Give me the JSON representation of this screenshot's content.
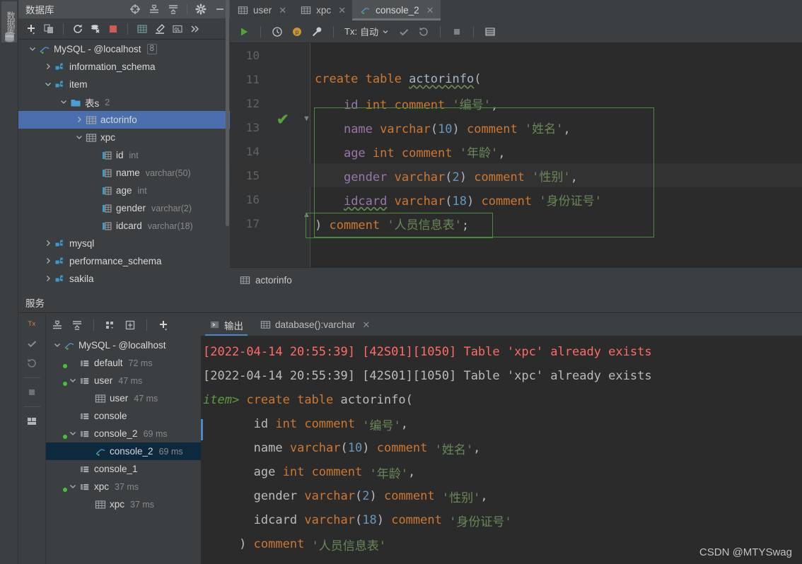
{
  "left_strip": {
    "vertical_tab_label": "数据库",
    "icon": "database-icon"
  },
  "db_panel": {
    "title": "数据库",
    "header_icons": [
      "crosshair-locate-icon",
      "expand-all-icon",
      "collapse-all-icon",
      "gear-icon",
      "minimize-icon"
    ],
    "toolbar_icons": [
      "add-icon",
      "copy-icon",
      "refresh-icon",
      "db-sync-icon",
      "stop-icon",
      "table-view-icon",
      "edit-icon",
      "query-console-icon",
      "more-chevrons-icon"
    ],
    "tree": [
      {
        "indent": 0,
        "arrow": "down",
        "icon": "mysql-icon",
        "label": "MySQL - @localhost",
        "badge": "8",
        "meta": "",
        "selected": false
      },
      {
        "indent": 1,
        "arrow": "right",
        "icon": "schema-icon",
        "label": "information_schema",
        "badge": "",
        "meta": "",
        "selected": false
      },
      {
        "indent": 1,
        "arrow": "down",
        "icon": "schema-icon",
        "label": "item",
        "badge": "",
        "meta": "",
        "selected": false
      },
      {
        "indent": 2,
        "arrow": "down",
        "icon": "folder-icon",
        "label": "表s",
        "badge": "",
        "meta": "2",
        "selected": false
      },
      {
        "indent": 3,
        "arrow": "right",
        "icon": "table-icon",
        "label": "actorinfo",
        "badge": "",
        "meta": "",
        "selected": true
      },
      {
        "indent": 3,
        "arrow": "down",
        "icon": "table-icon",
        "label": "xpc",
        "badge": "",
        "meta": "",
        "selected": false
      },
      {
        "indent": 4,
        "arrow": "none",
        "icon": "column-icon",
        "label": "id",
        "badge": "",
        "meta": "int",
        "selected": false
      },
      {
        "indent": 4,
        "arrow": "none",
        "icon": "column-icon",
        "label": "name",
        "badge": "",
        "meta": "varchar(50)",
        "selected": false
      },
      {
        "indent": 4,
        "arrow": "none",
        "icon": "column-icon",
        "label": "age",
        "badge": "",
        "meta": "int",
        "selected": false
      },
      {
        "indent": 4,
        "arrow": "none",
        "icon": "column-icon",
        "label": "gender",
        "badge": "",
        "meta": "varchar(2)",
        "selected": false
      },
      {
        "indent": 4,
        "arrow": "none",
        "icon": "column-icon",
        "label": "idcard",
        "badge": "",
        "meta": "varchar(18)",
        "selected": false
      },
      {
        "indent": 1,
        "arrow": "right",
        "icon": "schema-icon",
        "label": "mysql",
        "badge": "",
        "meta": "",
        "selected": false
      },
      {
        "indent": 1,
        "arrow": "right",
        "icon": "schema-icon",
        "label": "performance_schema",
        "badge": "",
        "meta": "",
        "selected": false
      },
      {
        "indent": 1,
        "arrow": "right",
        "icon": "schema-icon",
        "label": "sakila",
        "badge": "",
        "meta": "",
        "selected": false
      }
    ]
  },
  "editor": {
    "tabs": [
      {
        "label": "user",
        "icon": "table-icon",
        "active": false,
        "closable": true
      },
      {
        "label": "xpc",
        "icon": "table-icon",
        "active": false,
        "closable": true
      },
      {
        "label": "console_2",
        "icon": "mysql-icon",
        "active": true,
        "closable": true
      }
    ],
    "toolbar": {
      "run_label": "run-icon",
      "history_label": "history-icon",
      "profile_label": "p-badge-icon",
      "settings_label": "wrench-icon",
      "tx_label": "Tx:",
      "tx_value": "自动",
      "commit_label": "commit-icon",
      "rollback_label": "rollback-icon",
      "stop_label": "stop-icon",
      "datasource_label": "data-output-icon"
    },
    "lines": [
      {
        "num": "10",
        "tokens": [],
        "highlight": false
      },
      {
        "num": "11",
        "tokens": [
          {
            "t": "create table ",
            "c": "kw"
          },
          {
            "t": "actorinfo",
            "c": "ident wavy"
          },
          {
            "t": "(",
            "c": "plain"
          }
        ],
        "highlight": false
      },
      {
        "num": "12",
        "tokens": [
          {
            "t": "    ",
            "c": "plain"
          },
          {
            "t": "id",
            "c": "col"
          },
          {
            "t": " ",
            "c": "plain"
          },
          {
            "t": "int comment ",
            "c": "kw"
          },
          {
            "t": "'编号'",
            "c": "str"
          },
          {
            "t": ",",
            "c": "plain"
          }
        ],
        "highlight": false
      },
      {
        "num": "13",
        "tokens": [
          {
            "t": "    ",
            "c": "plain"
          },
          {
            "t": "name",
            "c": "col"
          },
          {
            "t": " ",
            "c": "plain"
          },
          {
            "t": "varchar",
            "c": "kw"
          },
          {
            "t": "(",
            "c": "plain"
          },
          {
            "t": "10",
            "c": "num"
          },
          {
            "t": ") ",
            "c": "plain"
          },
          {
            "t": "comment ",
            "c": "kw"
          },
          {
            "t": "'姓名'",
            "c": "str"
          },
          {
            "t": ",",
            "c": "plain"
          }
        ],
        "highlight": false
      },
      {
        "num": "14",
        "tokens": [
          {
            "t": "    ",
            "c": "plain"
          },
          {
            "t": "age",
            "c": "col"
          },
          {
            "t": " ",
            "c": "plain"
          },
          {
            "t": "int comment ",
            "c": "kw"
          },
          {
            "t": "'年龄'",
            "c": "str"
          },
          {
            "t": ",",
            "c": "plain"
          }
        ],
        "highlight": false
      },
      {
        "num": "15",
        "tokens": [
          {
            "t": "    ",
            "c": "plain"
          },
          {
            "t": "gender",
            "c": "col"
          },
          {
            "t": " ",
            "c": "plain"
          },
          {
            "t": "varchar",
            "c": "kw"
          },
          {
            "t": "(",
            "c": "plain"
          },
          {
            "t": "2",
            "c": "num"
          },
          {
            "t": ") ",
            "c": "plain"
          },
          {
            "t": "comment ",
            "c": "kw"
          },
          {
            "t": "'性别'",
            "c": "str"
          },
          {
            "t": ",",
            "c": "plain"
          }
        ],
        "highlight": true
      },
      {
        "num": "16",
        "tokens": [
          {
            "t": "    ",
            "c": "plain"
          },
          {
            "t": "idcard",
            "c": "col wavy"
          },
          {
            "t": " ",
            "c": "plain"
          },
          {
            "t": "varchar",
            "c": "kw"
          },
          {
            "t": "(",
            "c": "plain"
          },
          {
            "t": "18",
            "c": "num"
          },
          {
            "t": ") ",
            "c": "plain"
          },
          {
            "t": "comment ",
            "c": "kw"
          },
          {
            "t": "'身份证号'",
            "c": "str"
          }
        ],
        "highlight": false
      },
      {
        "num": "17",
        "tokens": [
          {
            "t": ") ",
            "c": "plain"
          },
          {
            "t": "comment ",
            "c": "kw"
          },
          {
            "t": "'人员信息表'",
            "c": "str"
          },
          {
            "t": ";",
            "c": "plain"
          }
        ],
        "highlight": false
      }
    ],
    "result_tab": {
      "label": "actorinfo",
      "icon": "table-icon"
    }
  },
  "services": {
    "title": "服务",
    "vtools": [
      "tx-icon",
      "commit-check-icon",
      "rollback-icon",
      "stop-icon",
      "layout-icon"
    ],
    "tree_toolbar": [
      "expand-all-icon",
      "collapse-all-icon",
      "group-icon",
      "new-window-icon",
      "add-icon"
    ],
    "tree": [
      {
        "indent": 0,
        "arrow": "down",
        "icon": "mysql-icon",
        "label": "MySQL - @localhost",
        "meta": "",
        "selected": false
      },
      {
        "indent": 1,
        "arrow": "none",
        "icon": "session-icon",
        "label": "default",
        "meta": "72 ms",
        "selected": false
      },
      {
        "indent": 1,
        "arrow": "down",
        "icon": "session-icon",
        "label": "user",
        "meta": "47 ms",
        "selected": false
      },
      {
        "indent": 2,
        "arrow": "none",
        "icon": "table-icon",
        "label": "user",
        "meta": "47 ms",
        "selected": false
      },
      {
        "indent": 1,
        "arrow": "none",
        "icon": "session-icon",
        "label": "console",
        "meta": "",
        "selected": false
      },
      {
        "indent": 1,
        "arrow": "down",
        "icon": "session-icon",
        "label": "console_2",
        "meta": "69 ms",
        "selected": false
      },
      {
        "indent": 2,
        "arrow": "none",
        "icon": "mysql-icon",
        "label": "console_2",
        "meta": "69 ms",
        "selected": true
      },
      {
        "indent": 1,
        "arrow": "none",
        "icon": "session-icon",
        "label": "console_1",
        "meta": "",
        "selected": false
      },
      {
        "indent": 1,
        "arrow": "down",
        "icon": "session-icon",
        "label": "xpc",
        "meta": "37 ms",
        "selected": false
      },
      {
        "indent": 2,
        "arrow": "none",
        "icon": "table-icon",
        "label": "xpc",
        "meta": "37 ms",
        "selected": false
      }
    ],
    "output_tabs": [
      {
        "label": "输出",
        "icon": "console-output-icon",
        "active": true,
        "closable": false
      },
      {
        "label": "database():varchar",
        "icon": "table-icon",
        "active": false,
        "closable": true
      }
    ],
    "output_lines": [
      {
        "tokens": [
          {
            "t": "[2022-04-14 20:55:39] [42S01][1050] Table 'xpc' already exists",
            "c": "err"
          }
        ]
      },
      {
        "tokens": [
          {
            "t": "[2022-04-14 20:55:39] [42S01][1050] Table 'xpc' already exists",
            "c": "oplain"
          }
        ]
      },
      {
        "tokens": [
          {
            "t": "item>",
            "c": "prompt"
          },
          {
            "t": " ",
            "c": "oplain"
          },
          {
            "t": "create table ",
            "c": "kw"
          },
          {
            "t": "actorinfo",
            "c": "oplain"
          },
          {
            "t": "(",
            "c": "oplain"
          }
        ]
      },
      {
        "tokens": [
          {
            "t": "       ",
            "c": "oplain"
          },
          {
            "t": "id",
            "c": "oplain"
          },
          {
            "t": " ",
            "c": "oplain"
          },
          {
            "t": "int comment ",
            "c": "kw"
          },
          {
            "t": "'编号'",
            "c": "str"
          },
          {
            "t": ",",
            "c": "oplain"
          }
        ]
      },
      {
        "tokens": [
          {
            "t": "       ",
            "c": "oplain"
          },
          {
            "t": "name",
            "c": "oplain"
          },
          {
            "t": " ",
            "c": "oplain"
          },
          {
            "t": "varchar",
            "c": "kw"
          },
          {
            "t": "(",
            "c": "oplain"
          },
          {
            "t": "10",
            "c": "num"
          },
          {
            "t": ") ",
            "c": "oplain"
          },
          {
            "t": "comment ",
            "c": "kw"
          },
          {
            "t": "'姓名'",
            "c": "str"
          },
          {
            "t": ",",
            "c": "oplain"
          }
        ]
      },
      {
        "tokens": [
          {
            "t": "       ",
            "c": "oplain"
          },
          {
            "t": "age",
            "c": "oplain"
          },
          {
            "t": " ",
            "c": "oplain"
          },
          {
            "t": "int comment ",
            "c": "kw"
          },
          {
            "t": "'年龄'",
            "c": "str"
          },
          {
            "t": ",",
            "c": "oplain"
          }
        ]
      },
      {
        "tokens": [
          {
            "t": "       ",
            "c": "oplain"
          },
          {
            "t": "gender",
            "c": "oplain"
          },
          {
            "t": " ",
            "c": "oplain"
          },
          {
            "t": "varchar",
            "c": "kw"
          },
          {
            "t": "(",
            "c": "oplain"
          },
          {
            "t": "2",
            "c": "num"
          },
          {
            "t": ") ",
            "c": "oplain"
          },
          {
            "t": "comment ",
            "c": "kw"
          },
          {
            "t": "'性别'",
            "c": "str"
          },
          {
            "t": ",",
            "c": "oplain"
          }
        ]
      },
      {
        "tokens": [
          {
            "t": "       ",
            "c": "oplain"
          },
          {
            "t": "idcard",
            "c": "oplain"
          },
          {
            "t": " ",
            "c": "oplain"
          },
          {
            "t": "varchar",
            "c": "kw"
          },
          {
            "t": "(",
            "c": "oplain"
          },
          {
            "t": "18",
            "c": "num"
          },
          {
            "t": ") ",
            "c": "oplain"
          },
          {
            "t": "comment ",
            "c": "kw"
          },
          {
            "t": "'身份证号'",
            "c": "str"
          }
        ]
      },
      {
        "tokens": [
          {
            "t": "     ) ",
            "c": "oplain"
          },
          {
            "t": "comment ",
            "c": "kw"
          },
          {
            "t": "'人员信息表'",
            "c": "str"
          }
        ]
      }
    ]
  },
  "watermark": "CSDN @MTYSwag",
  "colors": {
    "selection_blue": "#4b6eaf",
    "error_red": "#ff6b68",
    "keyword_orange": "#cc7832",
    "string_green": "#6a8759",
    "number_blue": "#6897bb",
    "column_purple": "#9876aa",
    "accent_tab": "#4a88c7",
    "panel_bg": "#3c3f41",
    "editor_bg": "#2b2b2b"
  }
}
